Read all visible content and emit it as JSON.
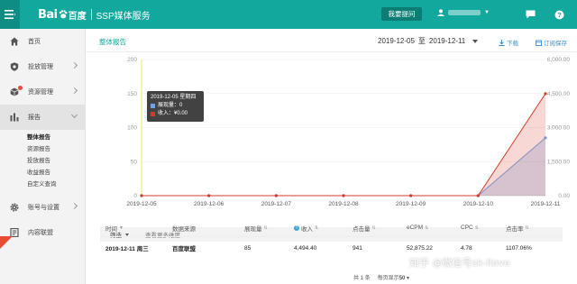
{
  "header": {
    "logo_text": "Bai",
    "logo_cn": "百度",
    "app_title": "SSP媒体服务",
    "ask_button": "我要提问",
    "icons": [
      "menu-icon",
      "user-icon",
      "message-icon",
      "help-icon"
    ]
  },
  "sidebar": {
    "items": [
      {
        "label": "首页",
        "icon": "home-icon"
      },
      {
        "label": "投放管理",
        "icon": "shield-icon"
      },
      {
        "label": "资源管理",
        "icon": "cube-icon"
      },
      {
        "label": "报告",
        "icon": "bar-chart-icon"
      },
      {
        "label": "账号与设置",
        "icon": "gear-icon"
      },
      {
        "label": "内容联盟",
        "icon": "document-icon"
      }
    ],
    "report_subitems": [
      "整体报告",
      "资源报告",
      "投放报告",
      "收益报告",
      "自定义查询"
    ]
  },
  "page": {
    "title": "整体报告",
    "date_start": "2019-12-05",
    "date_sep": "至",
    "date_end": "2019-12-11",
    "download": "下载",
    "subscribe": "订阅保存"
  },
  "tooltip": {
    "title": "2019-12-05 星期四",
    "row1": "展现量：0",
    "row2": "收入：¥0.00"
  },
  "chart_data": {
    "type": "line",
    "x": [
      "2019-12-05",
      "2019-12-06",
      "2019-12-07",
      "2019-12-08",
      "2019-12-09",
      "2019-12-10",
      "2019-12-11"
    ],
    "left_axis_ticks": [
      0,
      50,
      100,
      150,
      200
    ],
    "right_axis_ticks": [
      "0.00",
      "1,500.00",
      "3,000.00",
      "4,500.00",
      "6,000.00"
    ],
    "ylim_left": [
      0,
      200
    ],
    "ylim_right": [
      0,
      6000
    ],
    "series": [
      {
        "name": "展现量",
        "axis": "left",
        "color": "#6fa3e6",
        "values": [
          0,
          0,
          0,
          0,
          0,
          0,
          85
        ]
      },
      {
        "name": "收入",
        "axis": "right",
        "color": "#d63a2e",
        "values": [
          0,
          0,
          0,
          0,
          0,
          0,
          4494.4
        ]
      }
    ],
    "highlight_x": "2019-12-05"
  },
  "filter": {
    "label": "筛选",
    "more": "查看更多维度"
  },
  "table": {
    "headers": [
      "时间",
      "数据来源",
      "展现量",
      "收入",
      "点击量",
      "eCPM",
      "CPC",
      "点击率"
    ],
    "rows": [
      [
        "2019-12-11 周三",
        "百度联盟",
        "85",
        "4,494.40",
        "941",
        "52,875.22",
        "4.78",
        "1107.06%"
      ]
    ]
  },
  "pager": {
    "total": "共 1 条",
    "per_page_label": "每页显示",
    "per_page_value": "50"
  },
  "watermark": "知乎 @微信号sk-llove"
}
